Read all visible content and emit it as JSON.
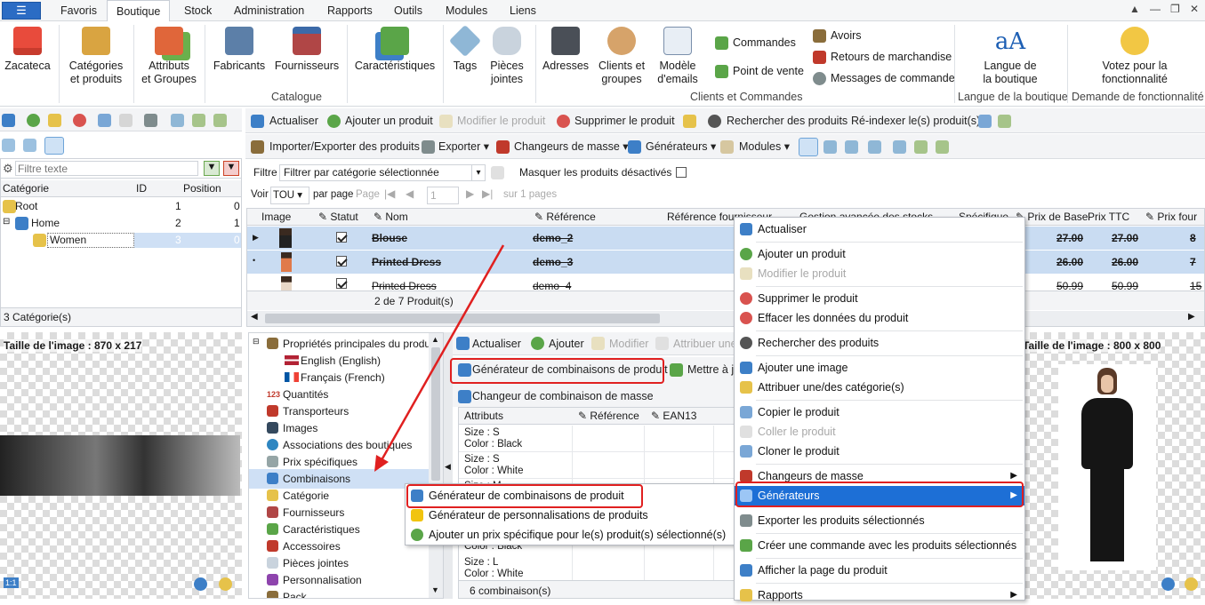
{
  "tabs": [
    "Favoris",
    "Boutique",
    "Stock",
    "Administration",
    "Rapports",
    "Outils",
    "Modules",
    "Liens"
  ],
  "active_tab": "Boutique",
  "ribbon": {
    "shop": "Zacateca",
    "btn_categories": "Catégories\net produits",
    "btn_attributes": "Attributs\net Groupes",
    "btn_manufacturers": "Fabricants",
    "btn_suppliers": "Fournisseurs",
    "btn_features": "Caractéristiques",
    "btn_tags": "Tags",
    "btn_attachments": "Pièces\njointes",
    "group_catalog": "Catalogue",
    "btn_addresses": "Adresses",
    "btn_customers": "Clients et\ngroupes",
    "btn_mail": "Modèle\nd'emails",
    "small_orders": "Commandes",
    "small_pos": "Point de vente",
    "small_credit": "Avoirs",
    "small_returns": "Retours de marchandise",
    "small_messages": "Messages de commande",
    "group_clients": "Clients et Commandes",
    "btn_lang": "Langue de\nla boutique",
    "group_lang": "Langue de la boutique",
    "btn_vote": "Votez pour la\nfonctionnalité",
    "group_feature": "Demande de fonctionnalité"
  },
  "left": {
    "filter_placeholder": "Filtre texte",
    "col_category": "Catégorie",
    "col_id": "ID",
    "col_position": "Position",
    "rows": [
      {
        "name": "Root",
        "id": "1",
        "pos": "0"
      },
      {
        "name": "Home",
        "id": "2",
        "pos": "1"
      },
      {
        "name": "Women",
        "id": "3",
        "pos": "0"
      }
    ],
    "count": "3 Catégorie(s)",
    "image_size": "Taille de l'image : 870 x 217"
  },
  "toolbar1": {
    "refresh": "Actualiser",
    "add": "Ajouter un produit",
    "edit": "Modifier le produit",
    "delete": "Supprimer le produit",
    "search": "Rechercher des produits",
    "reindex": "Ré-indexer le(s) produit(s)"
  },
  "toolbar2": {
    "import": "Importer/Exporter des produits",
    "export": "Exporter",
    "mass": "Changeurs de masse",
    "generators": "Générateurs",
    "modules": "Modules"
  },
  "filter": {
    "label": "Filtre",
    "value": "Filtrer par catégorie sélectionnée",
    "hide_disabled": "Masquer les produits désactivés"
  },
  "paging": {
    "view": "Voir",
    "per_page_value": "TOU",
    "per_page": "par page",
    "page": "Page",
    "page_value": "1",
    "of": "sur 1 pages"
  },
  "products": {
    "cols": [
      "Image",
      "Statut",
      "Nom",
      "Référence",
      "Référence fournisseur",
      "Gestion avancée des stocks",
      "Spécifique",
      "Prix de Base",
      "Prix TTC",
      "Prix four"
    ],
    "rows": [
      {
        "name": "Blouse",
        "ref": "demo_2",
        "base": "27.00",
        "ttc": "27.00",
        "four": "8"
      },
      {
        "name": "Printed Dress",
        "ref": "demo_3",
        "base": "26.00",
        "ttc": "26.00",
        "four": "7"
      },
      {
        "name": "Printed Dress",
        "ref": "demo_4",
        "base": "50.99",
        "ttc": "50.99",
        "four": "15"
      }
    ],
    "count": "2 de 7 Produit(s)"
  },
  "props": {
    "items": [
      "Propriétés principales du produit",
      "English (English)",
      "Français (French)",
      "Quantités",
      "Transporteurs",
      "Images",
      "Associations des boutiques",
      "Prix spécifiques",
      "Combinaisons",
      "Catégorie",
      "Fournisseurs",
      "Caractéristiques",
      "Accessoires",
      "Pièces jointes",
      "Personnalisation",
      "Pack"
    ]
  },
  "combo": {
    "refresh": "Actualiser",
    "add": "Ajouter",
    "edit": "Modifier",
    "assign": "Attribuer une",
    "generator": "Générateur de combinaisons de produit",
    "update": "Mettre à jo",
    "mass": "Changeur de combinaison de masse",
    "col_attr": "Attributs",
    "col_ref": "Référence",
    "col_ean": "EAN13",
    "rows": [
      {
        "a": "Size : S",
        "b": "Color : Black"
      },
      {
        "a": "Size : S",
        "b": "Color : White"
      },
      {
        "a": "Size : M",
        "b": ""
      },
      {
        "a": "",
        "b": "Color : Black"
      },
      {
        "a": "Size : L",
        "b": "Color : White"
      }
    ],
    "count": "6 combinaison(s)"
  },
  "submenu": [
    "Générateur de combinaisons de produit",
    "Générateur de personnalisations de produits",
    "Ajouter un prix spécifique pour le(s) produit(s) sélectionné(s)"
  ],
  "context": [
    {
      "label": "Actualiser",
      "dis": false
    },
    {
      "label": "Ajouter un produit",
      "dis": false
    },
    {
      "label": "Modifier le produit",
      "dis": true
    },
    {
      "label": "Supprimer le produit",
      "dis": false
    },
    {
      "label": "Effacer les données du produit",
      "dis": false
    },
    {
      "label": "Rechercher des produits",
      "dis": false
    },
    {
      "label": "Ajouter une image",
      "dis": false
    },
    {
      "label": "Attribuer une/des catégorie(s)",
      "dis": false
    },
    {
      "label": "Copier le produit",
      "dis": false
    },
    {
      "label": "Coller le produit",
      "dis": true
    },
    {
      "label": "Cloner le produit",
      "dis": false
    },
    {
      "label": "Changeurs de masse",
      "dis": false
    },
    {
      "label": "Générateurs",
      "dis": false
    },
    {
      "label": "Exporter les produits sélectionnés",
      "dis": false
    },
    {
      "label": "Créer une commande avec les produits sélectionnés",
      "dis": false
    },
    {
      "label": "Afficher la page du produit",
      "dis": false
    },
    {
      "label": "Rapports",
      "dis": false
    }
  ],
  "right_image_size": "Taille de l'image : 800 x 800",
  "zoom_badge": "1:1"
}
